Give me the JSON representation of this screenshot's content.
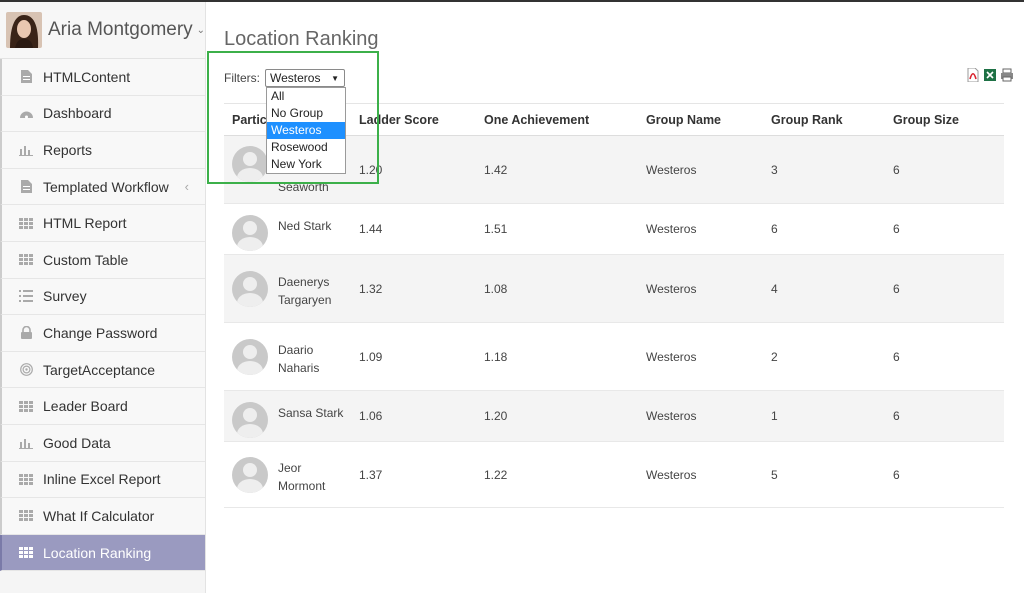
{
  "user": {
    "name": "Aria Montgomery"
  },
  "sidebar": {
    "items": [
      {
        "label": "HTMLContent",
        "icon": "document-icon"
      },
      {
        "label": "Dashboard",
        "icon": "dashboard-icon"
      },
      {
        "label": "Reports",
        "icon": "bar-chart-icon"
      },
      {
        "label": "Templated Workflow",
        "icon": "document-icon"
      },
      {
        "label": "HTML Report",
        "icon": "grid-icon"
      },
      {
        "label": "Custom Table",
        "icon": "grid-icon"
      },
      {
        "label": "Survey",
        "icon": "list-icon"
      },
      {
        "label": "Change Password",
        "icon": "lock-icon"
      },
      {
        "label": "TargetAcceptance",
        "icon": "target-icon"
      },
      {
        "label": "Leader Board",
        "icon": "grid-icon"
      },
      {
        "label": "Good Data",
        "icon": "bar-chart-icon"
      },
      {
        "label": "Inline Excel Report",
        "icon": "grid-icon"
      },
      {
        "label": "What If Calculator",
        "icon": "grid-icon"
      },
      {
        "label": "Location Ranking",
        "icon": "grid-icon"
      }
    ],
    "active": "Location Ranking"
  },
  "page": {
    "title": "Location Ranking"
  },
  "filters": {
    "label": "Filters:",
    "selected": "Westeros",
    "options": [
      "All",
      "No Group",
      "Westeros",
      "Rosewood",
      "New York"
    ]
  },
  "table": {
    "columns": [
      "Partic",
      "Ladder Score",
      "One Achievement",
      "Group Name",
      "Group Rank",
      "Group Size"
    ],
    "rows": [
      {
        "name": "Seaworth",
        "ladder": "1.20",
        "achievement": "1.42",
        "group": "Westeros",
        "rank": "3",
        "size": "6"
      },
      {
        "name": "Ned Stark",
        "ladder": "1.44",
        "achievement": "1.51",
        "group": "Westeros",
        "rank": "6",
        "size": "6"
      },
      {
        "name": "Daenerys Targaryen",
        "ladder": "1.32",
        "achievement": "1.08",
        "group": "Westeros",
        "rank": "4",
        "size": "6"
      },
      {
        "name": "Daario Naharis",
        "ladder": "1.09",
        "achievement": "1.18",
        "group": "Westeros",
        "rank": "2",
        "size": "6"
      },
      {
        "name": "Sansa Stark",
        "ladder": "1.06",
        "achievement": "1.20",
        "group": "Westeros",
        "rank": "1",
        "size": "6"
      },
      {
        "name": "Jeor Mormont",
        "ladder": "1.37",
        "achievement": "1.22",
        "group": "Westeros",
        "rank": "5",
        "size": "6"
      }
    ]
  },
  "colors": {
    "active_menu": "#9a9ac0",
    "highlight": "#3cb04a",
    "selected_option": "#1e90ff"
  }
}
